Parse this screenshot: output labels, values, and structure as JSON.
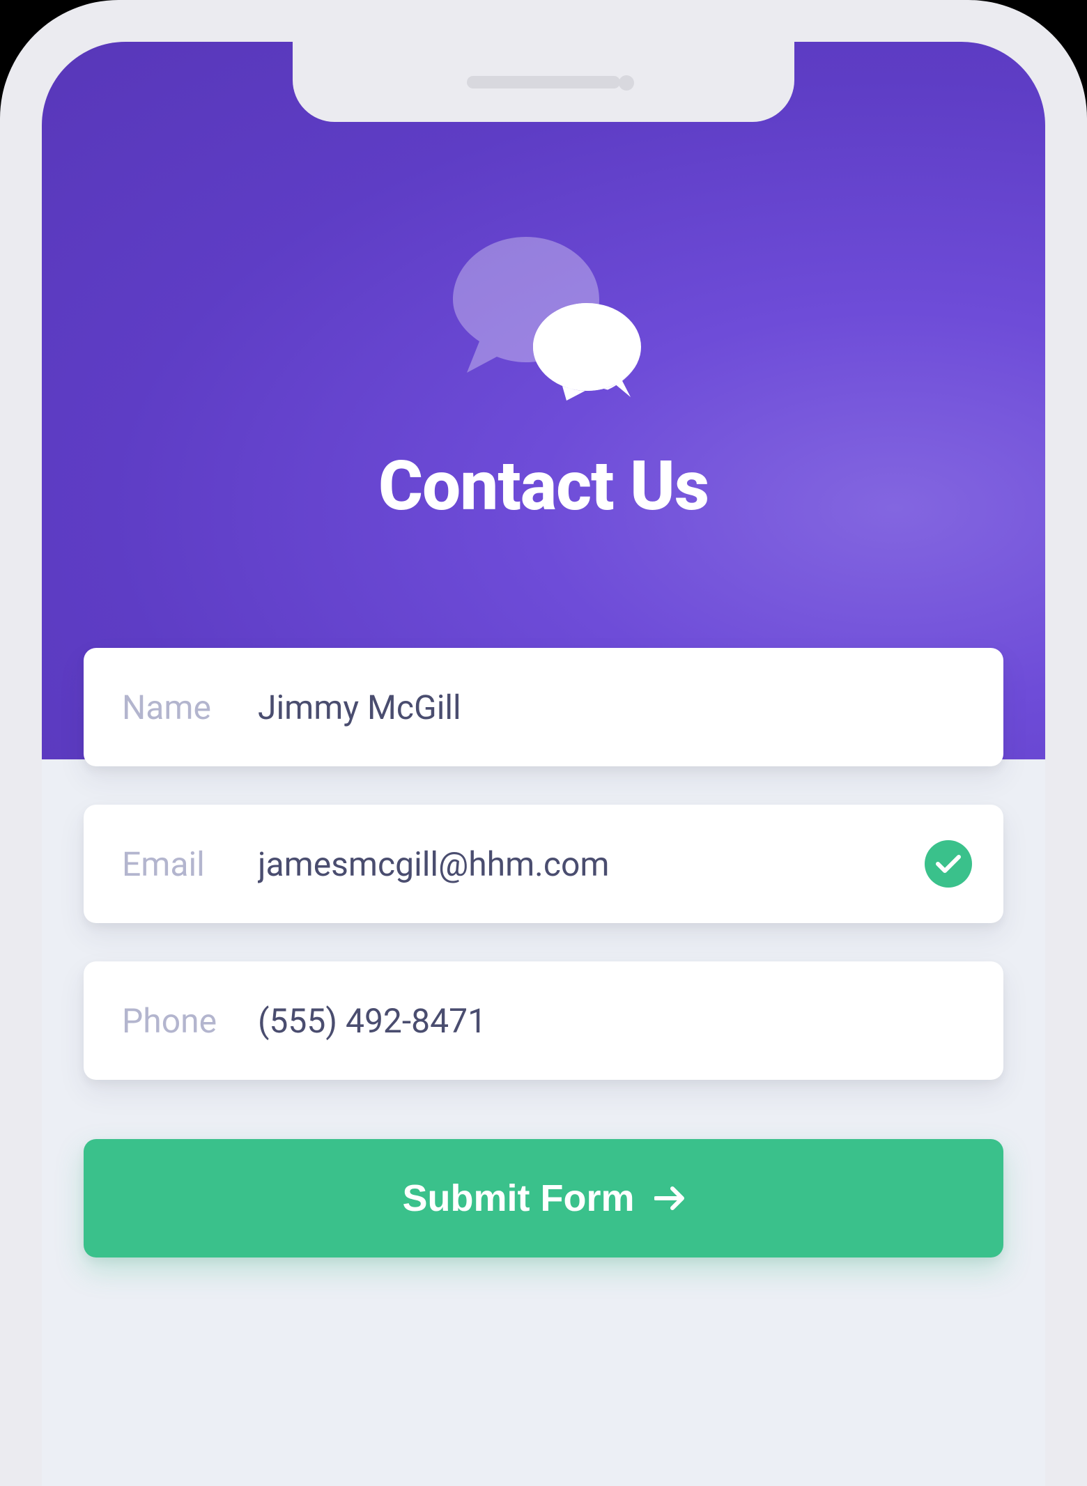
{
  "header": {
    "title": "Contact Us",
    "icon_name": "chat-bubbles-icon"
  },
  "form": {
    "fields": [
      {
        "label": "Name",
        "value": "Jimmy McGill",
        "validated": false
      },
      {
        "label": "Email",
        "value": "jamesmcgill@hhm.com",
        "validated": true
      },
      {
        "label": "Phone",
        "value": "(555) 492-8471",
        "validated": false
      }
    ],
    "submit_label": "Submit Form"
  },
  "colors": {
    "accent_purple": "#6e4cd8",
    "accent_green": "#3ac18b",
    "label_muted": "#b3b5ce",
    "input_text": "#4a4d6f"
  }
}
